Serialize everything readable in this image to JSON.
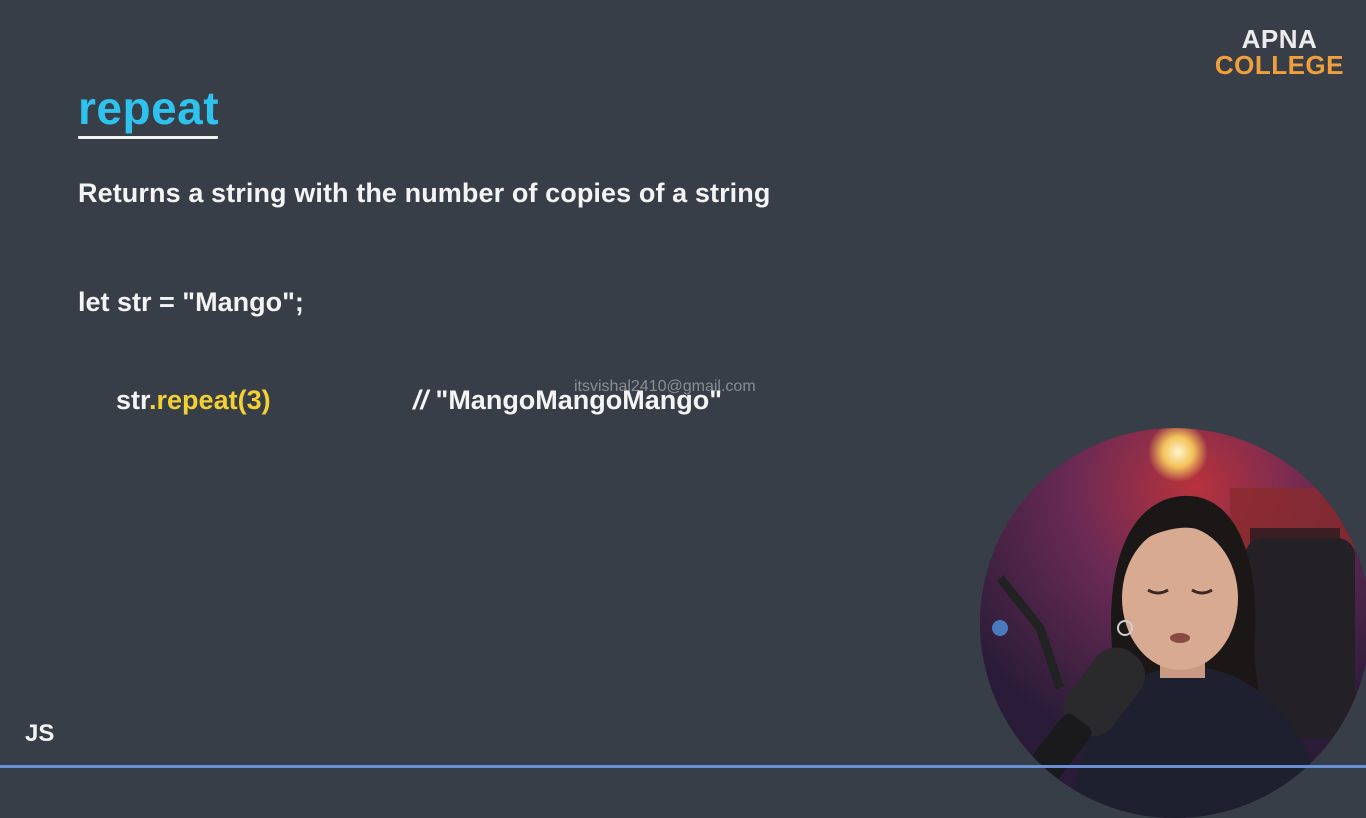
{
  "slide": {
    "title": "repeat",
    "subtitle": "Returns a string with the number of copies of a string",
    "code_declaration": "let str = \"Mango\";",
    "code_call_object": "str",
    "code_call_method": ".repeat(3)",
    "comment_slashes": "//",
    "comment_text": " \"MangoMangoMango\"",
    "watermark": "itsvishal2410@gmail.com",
    "language_tag": "JS"
  },
  "brand": {
    "line1": "APNA",
    "line2": "COLLEGE",
    "color_primary": "#ececec",
    "color_accent": "#f0a03a"
  },
  "colors": {
    "background": "#383e47",
    "title": "#2ec3ef",
    "method": "#f3d033",
    "text": "#f4f4f4"
  }
}
